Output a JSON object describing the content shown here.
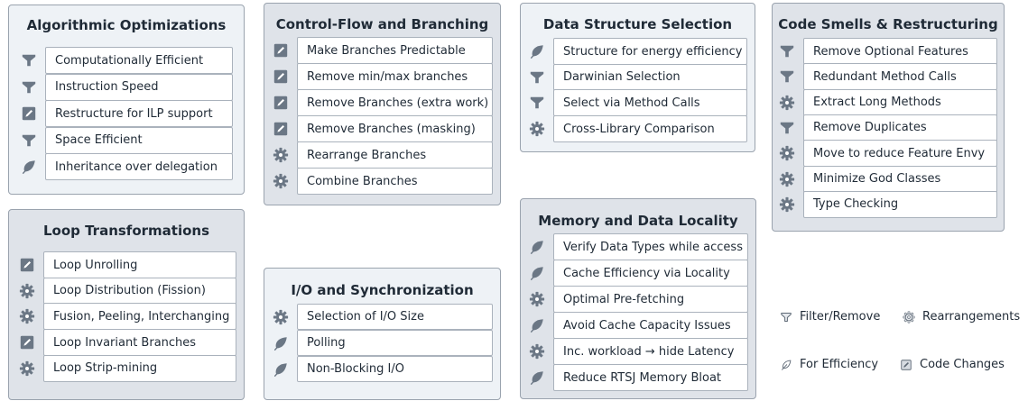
{
  "panels": {
    "algorithmic": {
      "title": "Algorithmic Optimizations",
      "items": [
        {
          "label": "Computationally Efficient",
          "icon": "funnel-icon"
        },
        {
          "label": "Instruction Speed",
          "icon": "funnel-icon"
        },
        {
          "label": "Restructure for ILP support",
          "icon": "pencil-square-icon"
        },
        {
          "label": "Space Efficient",
          "icon": "funnel-icon"
        },
        {
          "label": "Inheritance over delegation",
          "icon": "leaf-icon"
        }
      ]
    },
    "control_flow": {
      "title": "Control-Flow and Branching",
      "items": [
        {
          "label": "Make Branches Predictable",
          "icon": "pencil-square-icon"
        },
        {
          "label": "Remove min/max branches",
          "icon": "pencil-square-icon"
        },
        {
          "label": "Remove Branches (extra work)",
          "icon": "pencil-square-icon"
        },
        {
          "label": "Remove Branches (masking)",
          "icon": "pencil-square-icon"
        },
        {
          "label": "Rearrange Branches",
          "icon": "gear-icon"
        },
        {
          "label": "Combine Branches",
          "icon": "gear-icon"
        }
      ]
    },
    "data_structure": {
      "title": "Data Structure Selection",
      "items": [
        {
          "label": "Structure for energy efficiency",
          "icon": "leaf-icon"
        },
        {
          "label": "Darwinian Selection",
          "icon": "funnel-icon"
        },
        {
          "label": "Select via Method Calls",
          "icon": "funnel-icon"
        },
        {
          "label": "Cross-Library Comparison",
          "icon": "gear-icon"
        }
      ]
    },
    "code_smells": {
      "title": "Code Smells & Restructuring",
      "items": [
        {
          "label": "Remove Optional Features",
          "icon": "funnel-icon"
        },
        {
          "label": "Redundant Method Calls",
          "icon": "funnel-icon"
        },
        {
          "label": "Extract Long Methods",
          "icon": "gear-icon"
        },
        {
          "label": "Remove Duplicates",
          "icon": "funnel-icon"
        },
        {
          "label": "Move to reduce Feature Envy",
          "icon": "gear-icon"
        },
        {
          "label": "Minimize God Classes",
          "icon": "gear-icon"
        },
        {
          "label": "Type Checking",
          "icon": "gear-icon"
        }
      ]
    },
    "loop": {
      "title": "Loop Transformations",
      "items": [
        {
          "label": "Loop Unrolling",
          "icon": "pencil-square-icon"
        },
        {
          "label": "Loop Distribution (Fission)",
          "icon": "gear-icon"
        },
        {
          "label": "Fusion, Peeling, Interchanging",
          "icon": "gear-icon"
        },
        {
          "label": "Loop Invariant Branches",
          "icon": "pencil-square-icon"
        },
        {
          "label": "Loop Strip-mining",
          "icon": "gear-icon"
        }
      ]
    },
    "io": {
      "title": "I/O and Synchronization",
      "items": [
        {
          "label": "Selection of I/O Size",
          "icon": "gear-icon"
        },
        {
          "label": "Polling",
          "icon": "leaf-icon"
        },
        {
          "label": "Non-Blocking I/O",
          "icon": "leaf-icon"
        }
      ]
    },
    "memory": {
      "title": "Memory and Data Locality",
      "items": [
        {
          "label": "Verify Data Types while access",
          "icon": "leaf-icon"
        },
        {
          "label": "Cache Efficiency via Locality",
          "icon": "leaf-icon"
        },
        {
          "label": "Optimal Pre-fetching",
          "icon": "gear-icon"
        },
        {
          "label": "Avoid Cache Capacity Issues",
          "icon": "leaf-icon"
        },
        {
          "label": "Inc. workload → hide Latency",
          "icon": "gear-icon"
        },
        {
          "label": "Reduce RTSJ Memory Bloat",
          "icon": "leaf-icon"
        }
      ]
    }
  },
  "legend": [
    {
      "label": "Filter/Remove",
      "icon": "funnel-outline-icon"
    },
    {
      "label": "Rearrangements",
      "icon": "gear-outline-icon"
    },
    {
      "label": "For Efficiency",
      "icon": "leaf-outline-icon"
    },
    {
      "label": "Code Changes",
      "icon": "pencil-square-outline-icon"
    }
  ],
  "colors": {
    "icon_fill": "#6b7785",
    "panel_border": "#9aa3ae",
    "panel_light": "#eef2f6",
    "panel_dark": "#dfe3e9",
    "text": "#1f2a36"
  }
}
